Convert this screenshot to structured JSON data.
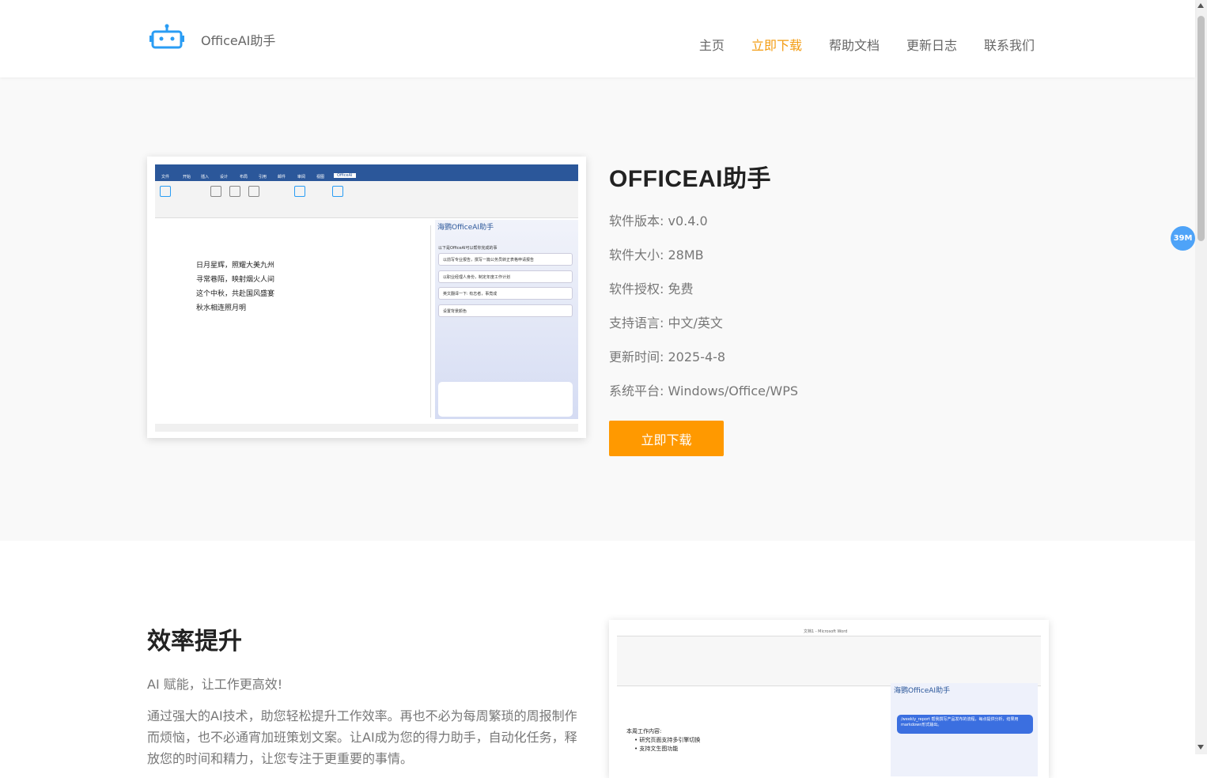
{
  "header": {
    "brand": "OfficeAI助手",
    "nav": [
      "主页",
      "立即下载",
      "帮助文档",
      "更新日志",
      "联系我们"
    ],
    "active_index": 1,
    "accent_color": "#f39c12"
  },
  "hero": {
    "title": "OFFICEAI助手",
    "meta": [
      "软件版本: v0.4.0",
      "软件大小: 28MB",
      "软件授权: 免费",
      "支持语言: 中文/英文",
      "更新时间: 2025-4-8",
      "系统平台: Windows/Office/WPS"
    ],
    "download_label": "立即下载",
    "button_color": "#ff9900"
  },
  "screenshot1": {
    "tabs": [
      "文件",
      "开始",
      "插入",
      "设计",
      "布局",
      "引用",
      "邮件",
      "审阅",
      "视图",
      "OfficeAI"
    ],
    "panel_title": "海鹦OfficeAI助手",
    "poem": [
      "日月星辉，照耀大美九州",
      "寻常巷陌，映射烟火人间",
      "这个中秋，共赴国风盛宴",
      "秋水相连照月明"
    ],
    "suggestions": [
      "以下是OfficeAI可以帮你完成的事",
      "以前写专业报告，撰写一篇公务员转正表格申请报告",
      "以职业经理人身份，制定年度工作计划",
      "英文翻译一下: 有志者，事竟成",
      "设置背景颜色"
    ]
  },
  "features": {
    "title": "效率提升",
    "tagline": "AI 赋能，让工作更高效!",
    "description": "通过强大的AI技术，助您轻松提升工作效率。再也不必为每周繁琐的周报制作而烦恼，也不必通宵加班策划文案。让AI成为您的得力助手，自动化任务，释放您的时间和精力，让您专注于更重要的事情。"
  },
  "screenshot2": {
    "title": "文档1 - Microsoft Word",
    "panel_title": "海鹦OfficeAI助手",
    "doc_lines": [
      "本周工作内容:",
      "• 研究页面支持多引擎切换",
      "• 支持文生图功能"
    ],
    "chat_bubble": "/weekly_report 帮我撰写产品发布的流程，每点提供分析，结果用markdown形式输出。"
  },
  "badge": "39M"
}
